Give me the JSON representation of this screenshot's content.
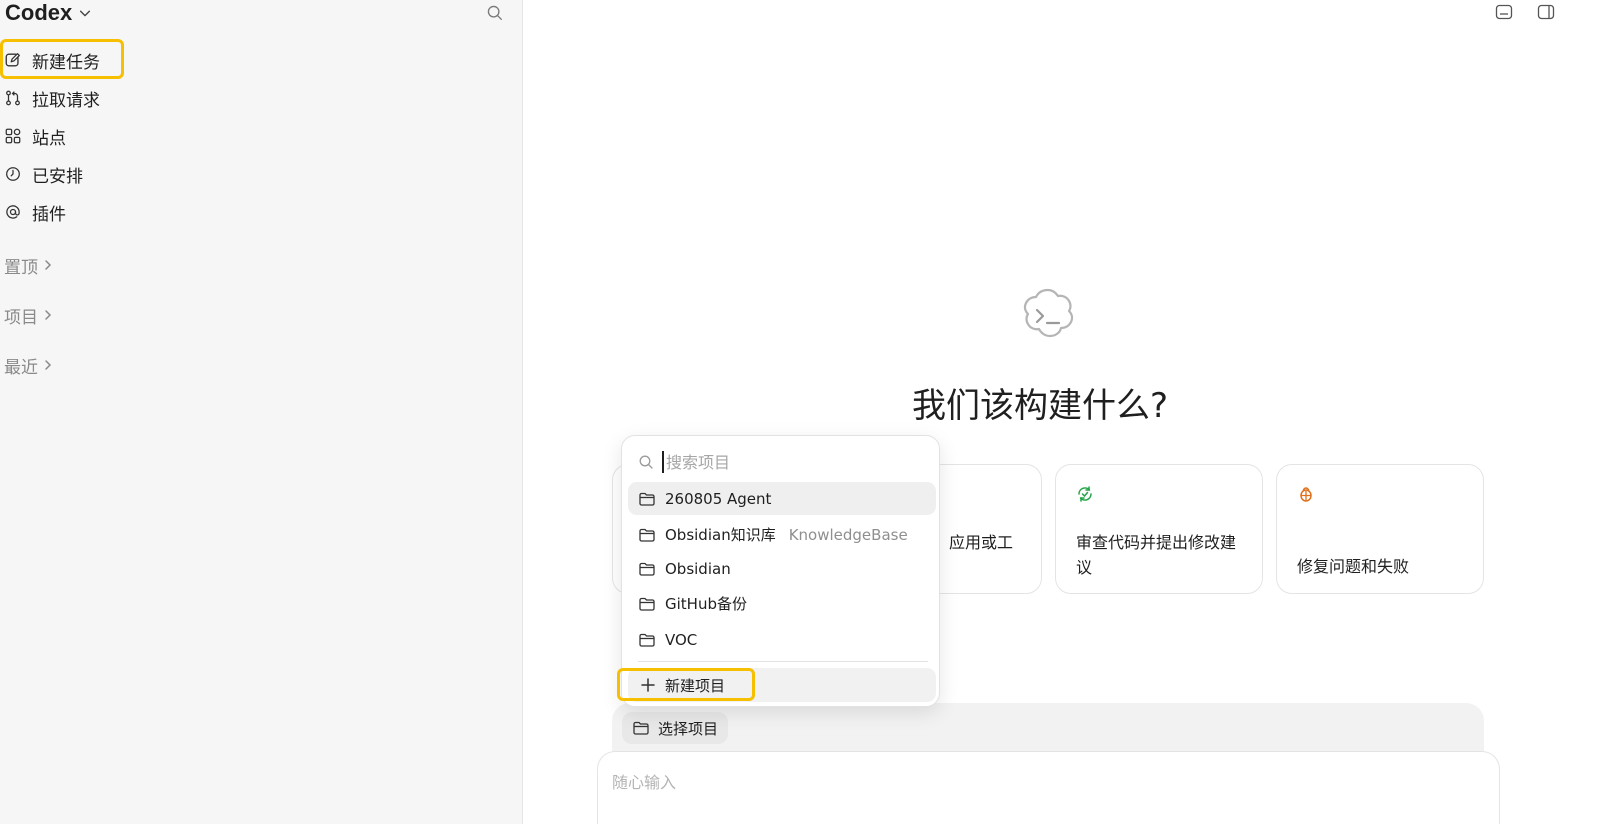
{
  "sidebar": {
    "app_name": "Codex",
    "nav": [
      {
        "label": "新建任务",
        "icon": "edit-icon"
      },
      {
        "label": "拉取请求",
        "icon": "pull-request-icon"
      },
      {
        "label": "站点",
        "icon": "grid-icon"
      },
      {
        "label": "已安排",
        "icon": "clock-icon"
      },
      {
        "label": "插件",
        "icon": "at-icon"
      }
    ],
    "sections": [
      {
        "label": "置顶"
      },
      {
        "label": "项目"
      },
      {
        "label": "最近"
      }
    ]
  },
  "main": {
    "headline": "我们该构建什么?",
    "cards": [
      {
        "label": "应用或工",
        "icon": "app-icon"
      },
      {
        "label": "审查代码并提出修改建议",
        "icon": "review-icon",
        "icon_color": "#22a447"
      },
      {
        "label": "修复问题和失败",
        "icon": "bug-icon",
        "icon_color": "#e0701c"
      }
    ],
    "choose_project_label": "选择项目",
    "composer_placeholder": "随心输入"
  },
  "dropdown": {
    "search_placeholder": "搜索项目",
    "projects": [
      {
        "name": "260805 Agent",
        "sub": ""
      },
      {
        "name": "Obsidian知识库",
        "sub": "KnowledgeBase"
      },
      {
        "name": "Obsidian",
        "sub": ""
      },
      {
        "name": "GitHub备份",
        "sub": ""
      },
      {
        "name": "VOC",
        "sub": ""
      }
    ],
    "new_project_label": "新建项目"
  },
  "colors": {
    "highlight": "#f6c000",
    "sidebar_bg": "#f6f6f6",
    "review_icon": "#22a447",
    "bug_icon": "#e0701c"
  }
}
